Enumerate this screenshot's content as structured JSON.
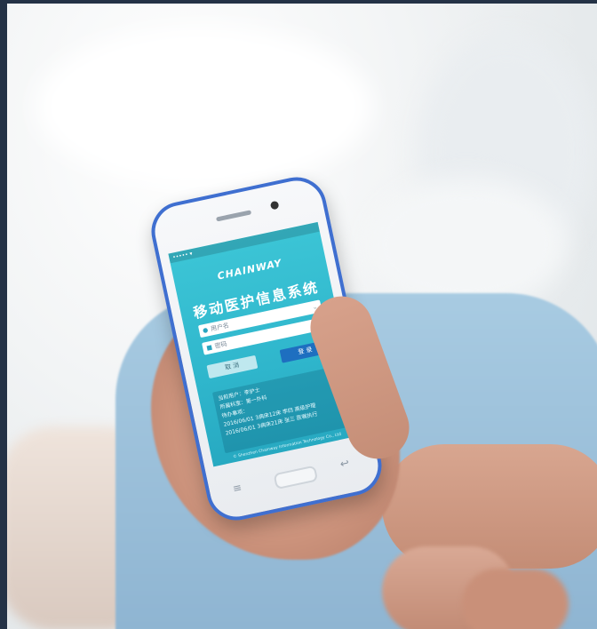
{
  "photo": {
    "subject": "hand holding smartphone showing medical login app",
    "colors": {
      "screen": "#2fb6cc",
      "phone_trim": "#3f6fd0",
      "sleeve": "#a8cbe2",
      "skin": "#cc937c"
    }
  },
  "app": {
    "brand": "CHAINWAY",
    "title": "移动医护信息系统",
    "username_placeholder": "用户名",
    "password_placeholder": "密码",
    "login_label": "登 录",
    "cancel_label": "取 消",
    "info_lines": [
      "当前用户：李护士",
      "所属科室：第一外科",
      "待办事项：",
      "2016/06/01  3病床12床 李四 高级护理",
      "2016/06/01  3病床21床 张三 医嘱执行"
    ],
    "footer": "© Shenzhen Chainway Information Technology Co., Ltd"
  },
  "icons": [
    "user-icon",
    "lock-icon",
    "chevron-down-icon",
    "eye-icon",
    "menu-key-icon",
    "home-button",
    "back-key-icon"
  ]
}
